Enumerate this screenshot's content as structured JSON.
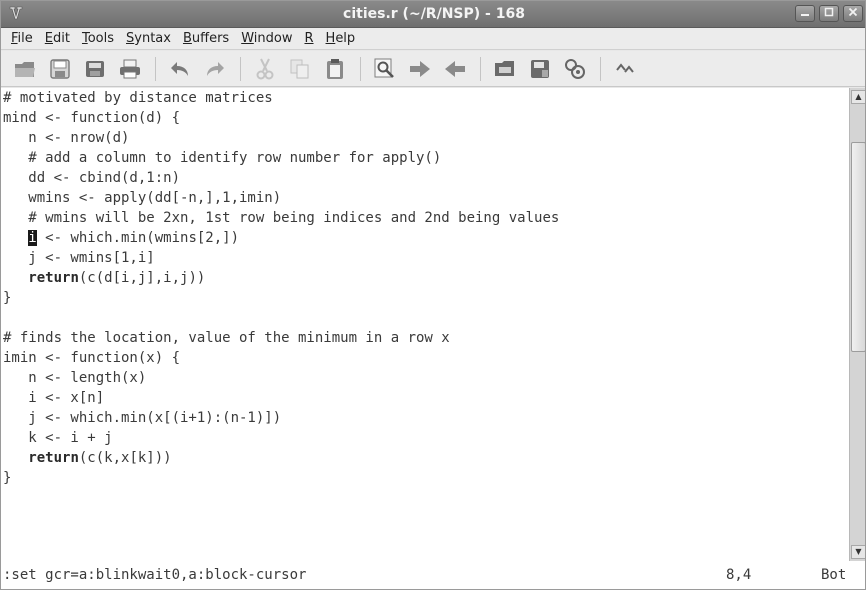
{
  "window": {
    "title": "cities.r (~/R/NSP) - 168",
    "app_icon": "vim-icon",
    "controls": [
      "minimize",
      "maximize",
      "close"
    ]
  },
  "menubar": {
    "items": [
      {
        "label": "File",
        "mnemonic": "F"
      },
      {
        "label": "Edit",
        "mnemonic": "E"
      },
      {
        "label": "Tools",
        "mnemonic": "T"
      },
      {
        "label": "Syntax",
        "mnemonic": "S"
      },
      {
        "label": "Buffers",
        "mnemonic": "B"
      },
      {
        "label": "Window",
        "mnemonic": "W"
      },
      {
        "label": "R",
        "mnemonic": "R"
      },
      {
        "label": "Help",
        "mnemonic": "H"
      }
    ]
  },
  "toolbar": {
    "buttons": [
      "open-icon",
      "save-icon",
      "save-all-icon",
      "print-icon",
      "undo-icon",
      "redo-icon",
      "cut-icon",
      "copy-icon",
      "paste-icon",
      "find-replace-icon",
      "find-next-icon",
      "find-prev-icon",
      "load-session-icon",
      "save-session-icon",
      "run-script-icon",
      "make-icon"
    ]
  },
  "editor": {
    "lines": [
      "# motivated by distance matrices",
      "mind <- function(d) {",
      "   n <- nrow(d)",
      "   # add a column to identify row number for apply()",
      "   dd <- cbind(d,1:n)",
      "   wmins <- apply(dd[-n,],1,imin)",
      "   # wmins will be 2xn, 1st row being indices and 2nd being values",
      "   i <- which.min(wmins[2,])",
      "   j <- wmins[1,i]",
      "   return(c(d[i,j],i,j))",
      "}",
      "",
      "# finds the location, value of the minimum in a row x",
      "imin <- function(x) {",
      "   n <- length(x)",
      "   i <- x[n]",
      "   j <- which.min(x[(i+1):(n-1)])",
      "   k <- i + j",
      "   return(c(k,x[k]))",
      "}"
    ],
    "cursor": {
      "line": 8,
      "column": 4
    }
  },
  "statusline": {
    "command": ":set gcr=a:blinkwait0,a:block-cursor",
    "position": "8,4",
    "scroll": "Bot"
  }
}
